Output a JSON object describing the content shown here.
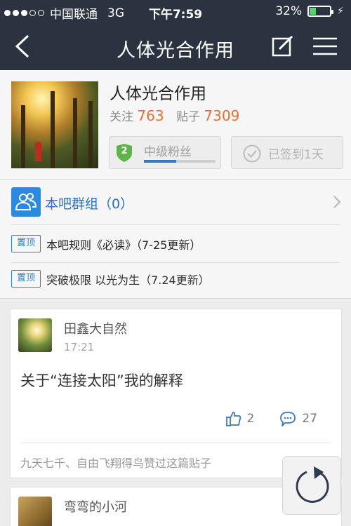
{
  "status_bar": {
    "carrier": "中国联通",
    "network": "3G",
    "time": "下午7:59",
    "battery": "32%",
    "battery_level": 0.32
  },
  "nav": {
    "title": "人体光合作用"
  },
  "forum": {
    "name": "人体光合作用",
    "follow_label": "关注",
    "follow_count": "763",
    "posts_label": "贴子",
    "posts_count": "7309",
    "level_number": "2",
    "level_name": "中级粉丝",
    "level_progress": 0.45,
    "signin_label": "已签到1天"
  },
  "group": {
    "label": "本吧群组（0）"
  },
  "top_posts": [
    {
      "tag": "置顶",
      "title": "本吧规则《必读》（7-25更新）"
    },
    {
      "tag": "置顶",
      "title": "突破极限 以光为生（7.24更新）"
    }
  ],
  "posts": [
    {
      "author": "田鑫大自然",
      "time": "17:21",
      "title": "关于“连接太阳”我的解释",
      "likes": "2",
      "comments": "27",
      "likers_names": "九天七千、自由飞翔得鸟",
      "likers_suffix": "赞过这篇贴子"
    },
    {
      "author": "弯弯的小河"
    }
  ],
  "colors": {
    "nav_bg": "#2b3340",
    "accent_blue": "#2a8ae2",
    "count_orange": "#f06d2c"
  }
}
